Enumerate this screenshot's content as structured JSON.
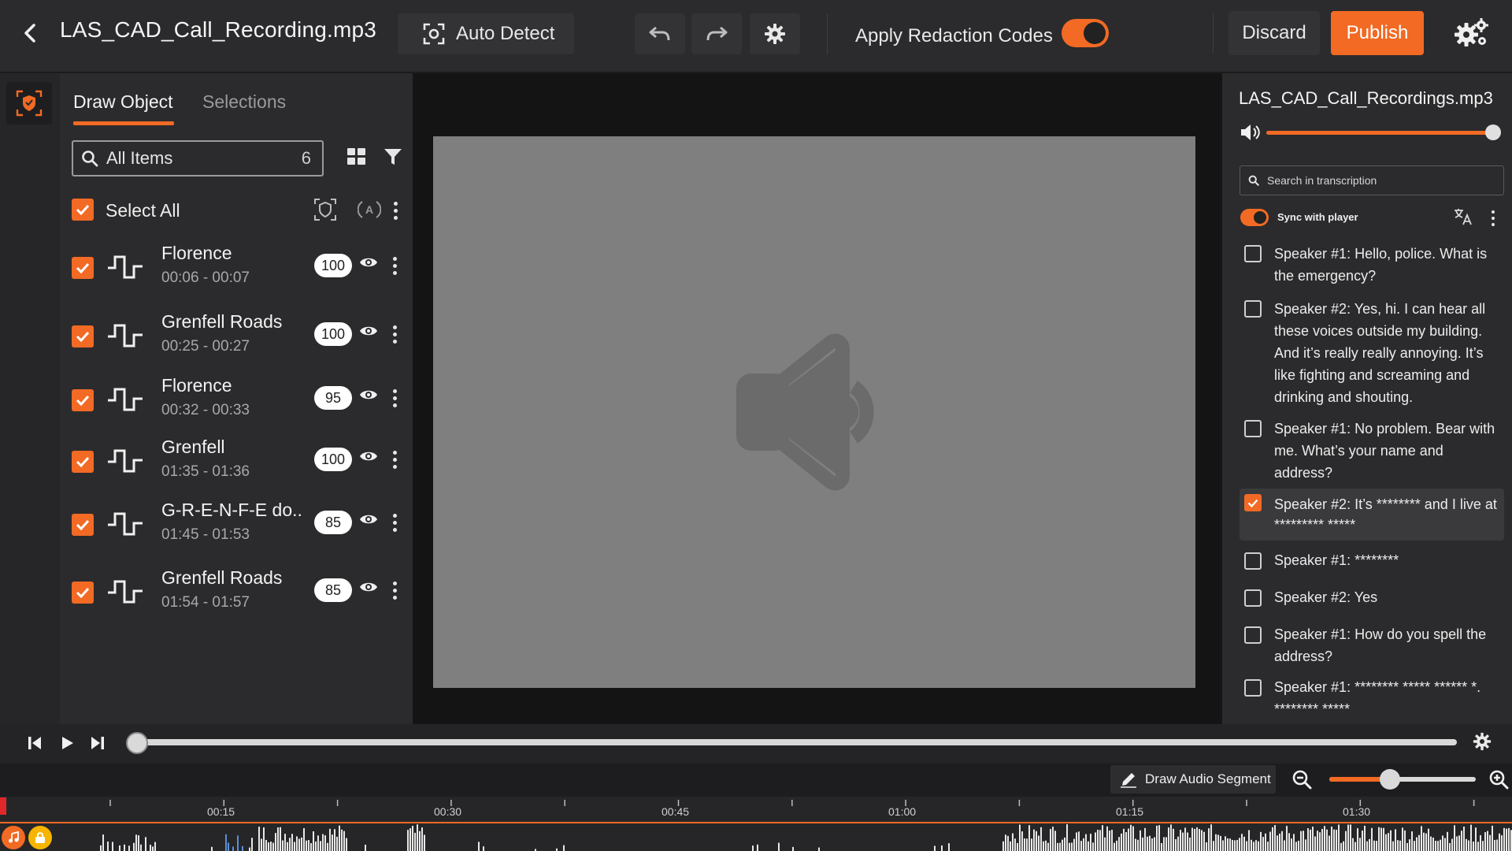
{
  "header": {
    "file_name": "LAS_CAD_Call_Recording.mp3",
    "auto_detect_label": "Auto Detect",
    "apply_redaction_label": "Apply Redaction Codes",
    "apply_redaction_on": true,
    "discard_label": "Discard",
    "publish_label": "Publish"
  },
  "left_panel": {
    "tabs": [
      {
        "label": "Draw Object",
        "active": true
      },
      {
        "label": "Selections",
        "active": false
      }
    ],
    "search": {
      "placeholder": "All Items",
      "count": "6"
    },
    "select_all_label": "Select All",
    "items": [
      {
        "name": "Florence",
        "time": "00:06 - 00:07",
        "score": "100",
        "checked": true
      },
      {
        "name": "Grenfell Roads",
        "time": "00:25 - 00:27",
        "score": "100",
        "checked": true
      },
      {
        "name": "Florence",
        "time": "00:32 - 00:33",
        "score": "95",
        "checked": true
      },
      {
        "name": "Grenfell",
        "time": "01:35 - 01:36",
        "score": "100",
        "checked": true
      },
      {
        "name": "G-R-E-N-F-E do..",
        "time": "01:45 - 01:53",
        "score": "85",
        "checked": true
      },
      {
        "name": "Grenfell Roads",
        "time": "01:54 - 01:57",
        "score": "85",
        "checked": true
      }
    ]
  },
  "right_panel": {
    "file_name": "LAS_CAD_Call_Recordings.mp3",
    "volume": 1.0,
    "search_placeholder": "Search in transcription",
    "sync_label": "Sync with player",
    "sync_on": true,
    "segments": [
      {
        "text": "Speaker #1: Hello, police. What is the emergency?",
        "checked": false
      },
      {
        "text": "Speaker #2: Yes, hi. I can hear all these voices outside my building. And it’s really really annoying. It’s like fighting and screaming and drinking and shouting.",
        "checked": false
      },
      {
        "text": "Speaker #1: No problem. Bear with me. What’s your name and address?",
        "checked": false
      },
      {
        "text": "Speaker #2: It’s ******** and I live at ********* *****",
        "checked": true
      },
      {
        "text": "Speaker #1: ********",
        "checked": false
      },
      {
        "text": "Speaker #2: Yes",
        "checked": false
      },
      {
        "text": "Speaker #1: How do you spell the address?",
        "checked": false
      },
      {
        "text": "Speaker #1: ******** ***** ****** *. ******** *****",
        "checked": false
      }
    ]
  },
  "player": {
    "progress": 0.0
  },
  "timeline": {
    "draw_segment_label": "Draw Audio Segment",
    "zoom_level": 0.4,
    "ticks": [
      "00:15",
      "00:30",
      "00:45",
      "01:00",
      "01:15",
      "01:30"
    ]
  },
  "colors": {
    "accent": "#f26a24",
    "lock": "#f7b500",
    "playhead": "#e0282b"
  }
}
